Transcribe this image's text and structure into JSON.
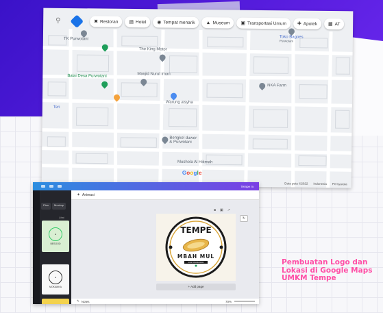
{
  "map": {
    "toolbar_chips": [
      {
        "icon": "fork-knife-icon",
        "label": "Restoran"
      },
      {
        "icon": "bed-icon",
        "label": "Hotel"
      },
      {
        "icon": "camera-icon",
        "label": "Tempat menarik"
      },
      {
        "icon": "museum-icon",
        "label": "Museum"
      },
      {
        "icon": "bus-icon",
        "label": "Transportasi Umum"
      },
      {
        "icon": "pharmacy-icon",
        "label": "Apotek"
      },
      {
        "icon": "atm-icon",
        "label": "AT"
      }
    ],
    "places": {
      "tk_purwotani": "TK Purwotani",
      "the_king_motor": "The King Motor",
      "toko_bagoes": "Toko Bagoes",
      "toko_bagoes_sub": "Purwotani",
      "balai_desa": "Balai Desa Purwotani",
      "masjid": "Masjid Nurul Iman",
      "nka_farm": "NKA Farm",
      "warung": "Warung aisyha",
      "teri": "Teri",
      "bengkel": "Bengkel duwer",
      "bengkel_sub": "& Purwotani",
      "mushola": "Mushola Al Hikmah"
    },
    "google_logo": [
      "G",
      "o",
      "o",
      "g",
      "l",
      "e"
    ],
    "footer": {
      "data": "Data peta ©2022",
      "country": "Indonesia",
      "terms": "Persyarata"
    }
  },
  "canva": {
    "header_title": "Tempe m",
    "toolbar_label": "Animasi",
    "panel_tabs": [
      "Plan",
      "Mockup"
    ],
    "panel_sub": "Lihat",
    "thumb1_text": "BESOOD",
    "thumb2_text": "MOKAMKA",
    "logo": {
      "title": "TEMPE",
      "name": "MBAH MUL",
      "tagline": "082785960000"
    },
    "add_page_label": "+ Add page",
    "notes_label": "Notes",
    "zoom": "70%"
  },
  "caption": {
    "lines": [
      "Pembuatan Logo dan",
      "Lokasi di Google Maps",
      "UMKM Tempe"
    ]
  },
  "colors": {
    "purple_bg": "#3a12c8",
    "caption_pink": "#ff4fa6",
    "logo_gold": "#d9a63a"
  }
}
